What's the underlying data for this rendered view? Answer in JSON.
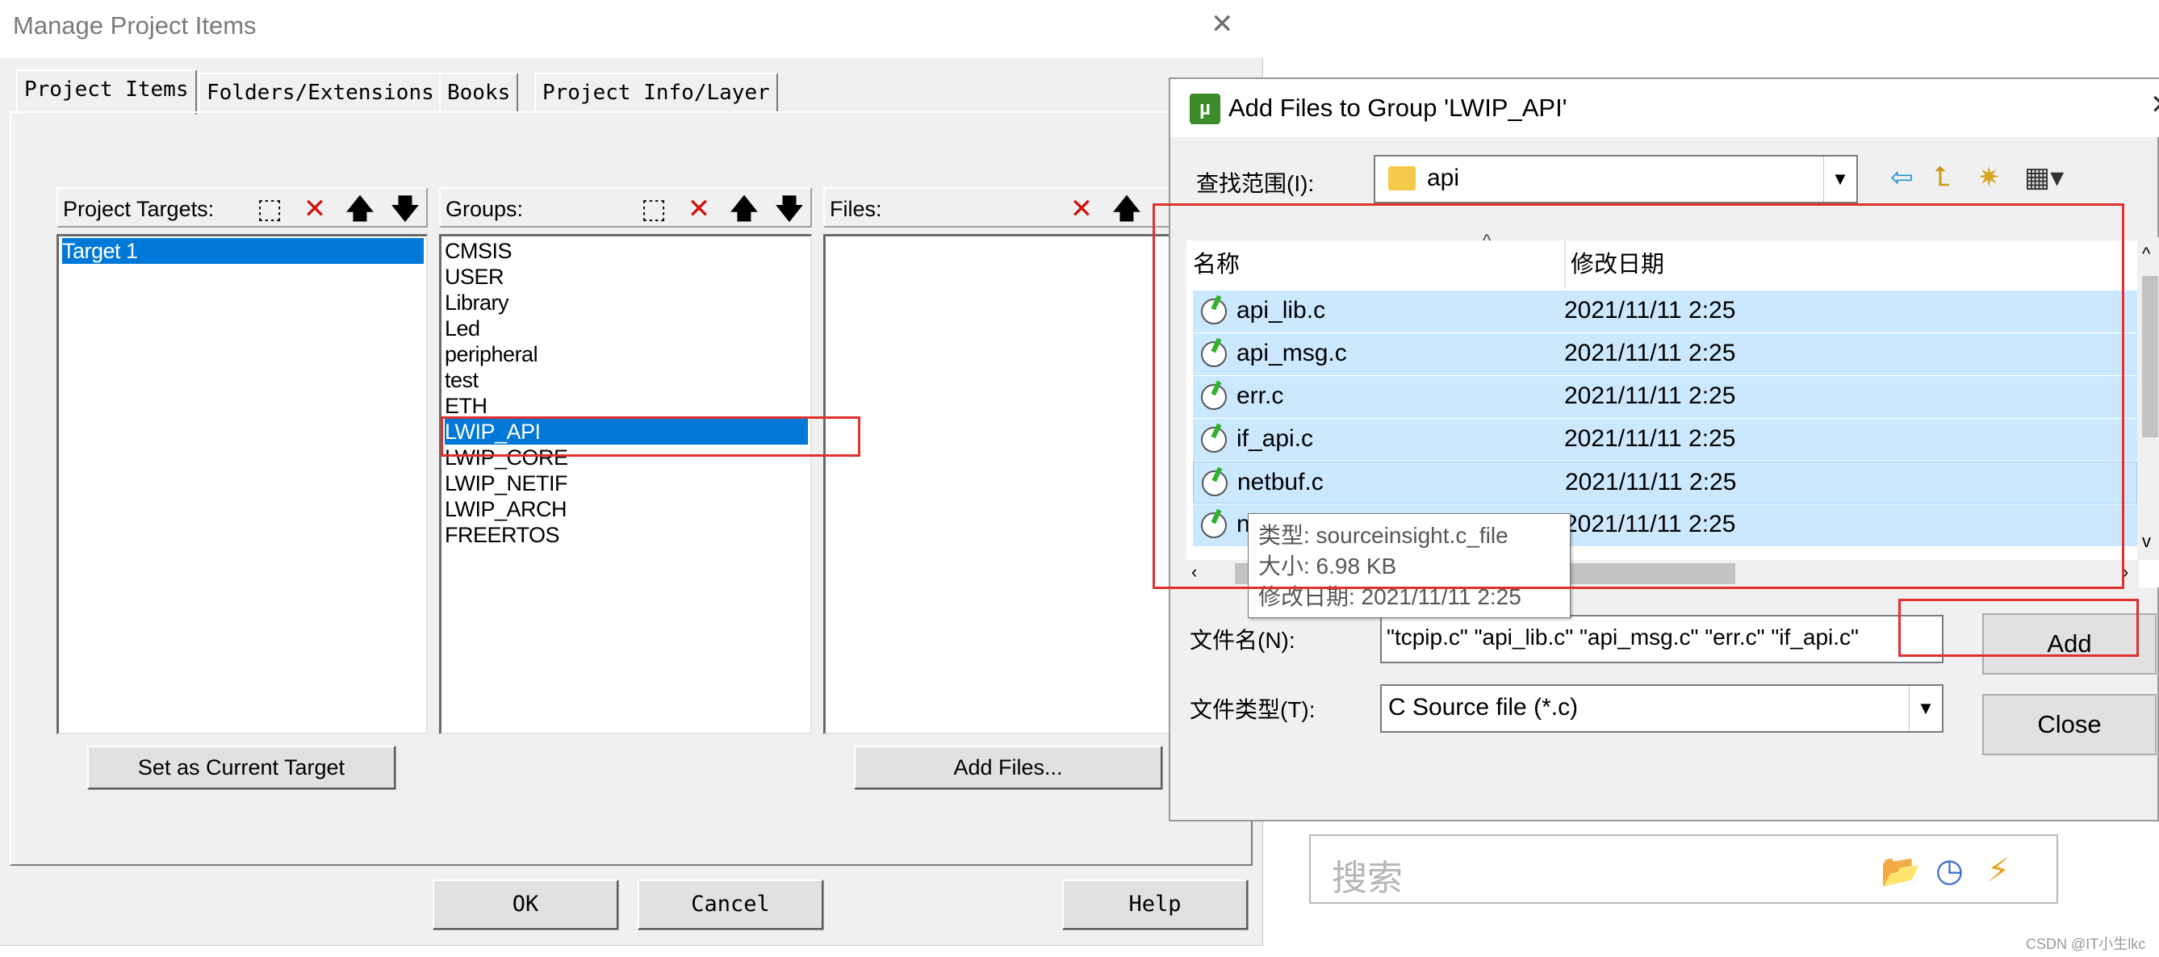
{
  "manage_window": {
    "title": "Manage Project Items",
    "tabs": [
      "Project Items",
      "Folders/Extensions",
      "Books",
      "Project Info/Layer"
    ],
    "targets": {
      "label": "Project Targets:",
      "items": [
        "Target 1"
      ],
      "selected": "Target 1",
      "button": "Set as Current Target"
    },
    "groups": {
      "label": "Groups:",
      "items": [
        "CMSIS",
        "USER",
        "Library",
        "Led",
        "peripheral",
        "test",
        "ETH",
        "LWIP_API",
        "LWIP_CORE",
        "LWIP_NETIF",
        "LWIP_ARCH",
        "FREERTOS"
      ],
      "selected": "LWIP_API"
    },
    "files": {
      "label": "Files:",
      "button": "Add Files..."
    },
    "buttons": {
      "ok": "OK",
      "cancel": "Cancel",
      "help": "Help"
    }
  },
  "add_files_dialog": {
    "title": "Add Files to Group 'LWIP_API'",
    "look_in_label": "查找范围(I):",
    "look_in_value": "api",
    "columns": {
      "name": "名称",
      "modified": "修改日期"
    },
    "files": [
      {
        "name": "api_lib.c",
        "modified": "2021/11/11 2:25"
      },
      {
        "name": "api_msg.c",
        "modified": "2021/11/11 2:25"
      },
      {
        "name": "err.c",
        "modified": "2021/11/11 2:25"
      },
      {
        "name": "if_api.c",
        "modified": "2021/11/11 2:25"
      },
      {
        "name": "netbuf.c",
        "modified": "2021/11/11 2:25"
      },
      {
        "name": "n",
        "modified": "2021/11/11 2:25"
      }
    ],
    "tooltip": {
      "type": "类型: sourceinsight.c_file",
      "size": "大小: 6.98 KB",
      "date": "修改日期: 2021/11/11 2:25"
    },
    "file_name_label": "文件名(N):",
    "file_name_value": "\"tcpip.c\" \"api_lib.c\" \"api_msg.c\" \"err.c\" \"if_api.c\"",
    "file_type_label": "文件类型(T):",
    "file_type_value": "C Source file (*.c)",
    "buttons": {
      "add": "Add",
      "close": "Close"
    }
  },
  "background": {
    "search_placeholder": "搜索",
    "watermark": "CSDN @IT小生lkc"
  },
  "icons": {
    "new": "new-item-icon",
    "delete": "delete-x-icon",
    "up": "move-up-arrow-icon",
    "down": "move-down-arrow-icon",
    "back": "back-arrow-icon",
    "up_folder": "up-folder-icon",
    "new_folder": "new-folder-icon",
    "view_menu": "view-menu-icon"
  },
  "colors": {
    "selection": "#0078d7",
    "file_selection": "#cce8ff",
    "annotation": "#e03030"
  }
}
